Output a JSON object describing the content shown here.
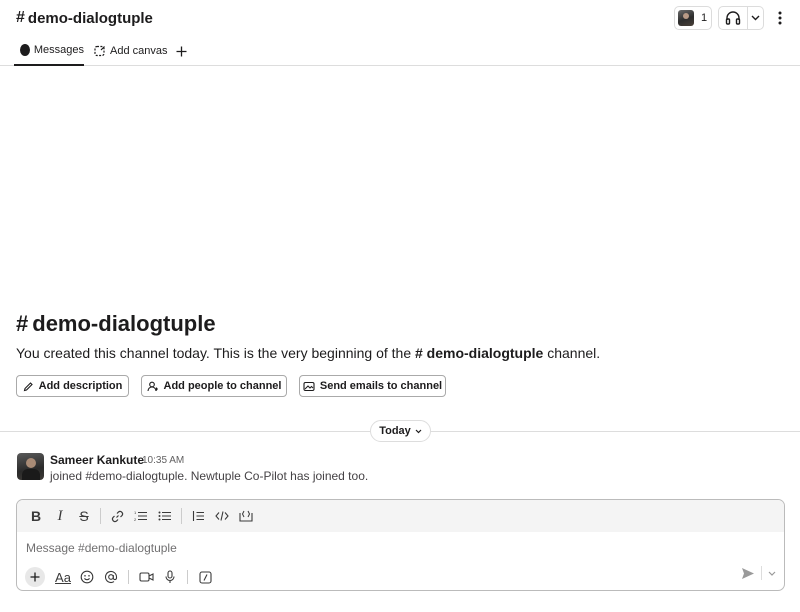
{
  "header": {
    "channel_hash": "#",
    "channel_name": "demo-dialogtuple",
    "member_count": "1"
  },
  "tabs": [
    {
      "label": "Messages",
      "icon": "message-bubble-icon",
      "active": true
    },
    {
      "label": "Add canvas",
      "icon": "canvas-icon"
    }
  ],
  "intro": {
    "hash": "#",
    "title": "demo-dialogtuple",
    "desc_before": "You created this channel today. This is the very beginning of the ",
    "desc_channel": "# demo-dialogtuple",
    "desc_after": " channel.",
    "buttons": {
      "add_description": "Add description",
      "add_people": "Add people to channel",
      "send_emails": "Send emails to channel"
    }
  },
  "divider": {
    "label": "Today"
  },
  "message": {
    "author": "Sameer Kankute",
    "time": "10:35 AM",
    "text": "joined #demo-dialogtuple. Newtuple Co-Pilot has joined too."
  },
  "composer": {
    "placeholder": "Message #demo-dialogtuple",
    "format_label": "Aa"
  },
  "colors": {
    "text": "#1d1c1d",
    "border": "#dddddd",
    "toolbar_bg": "#f4f4f4"
  }
}
